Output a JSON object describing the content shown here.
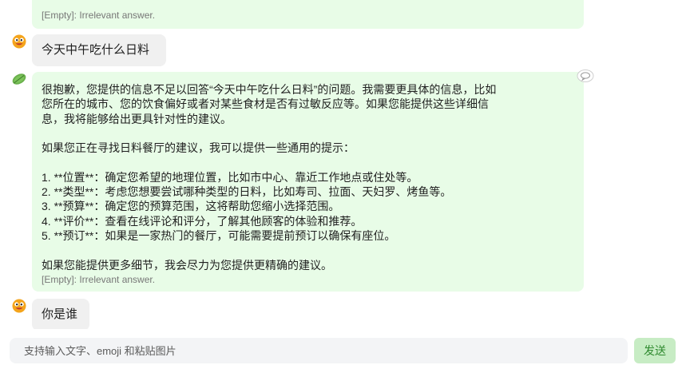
{
  "messages": {
    "top_tag": "[Empty]: Irrelevant answer.",
    "user1": "今天中午吃什么日料",
    "bot": {
      "lines": [
        "很抱歉，您提供的信息不足以回答“今天中午吃什么日料”的问题。我需要更具体的信息，比如",
        "您所在的城市、您的饮食偏好或者对某些食材是否有过敏反应等。如果您能提供这些详细信",
        "息，我将能够给出更具针对性的建议。",
        "",
        "如果您正在寻找日料餐厅的建议，我可以提供一些通用的提示：",
        "",
        "1. **位置**：确定您希望的地理位置，比如市中心、靠近工作地点或住处等。",
        "2. **类型**：考虑您想要尝试哪种类型的日料，比如寿司、拉面、天妇罗、烤鱼等。",
        "3. **预算**：确定您的预算范围，这将帮助您缩小选择范围。",
        "4. **评价**：查看在线评论和评分，了解其他顾客的体验和推荐。",
        "5. **预订**：如果是一家热门的餐厅，可能需要提前预订以确保有座位。",
        "",
        "如果您能提供更多细节，我会尽力为您提供更精确的建议。"
      ],
      "tag": "[Empty]: Irrelevant answer."
    },
    "user2": "你是谁"
  },
  "composer": {
    "placeholder": "支持输入文字、emoji 和粘贴图片",
    "send_label": "发送"
  },
  "icons": {
    "user_avatar": "emoji-face-icon",
    "bot_avatar": "leaf-icon",
    "comment": "speech-bubble-icon"
  },
  "colors": {
    "bot_bubble": "#e8fce7",
    "user_bubble": "#f0f0f0",
    "send_button": "#c7ecc4",
    "send_text": "#2f8a2f"
  }
}
